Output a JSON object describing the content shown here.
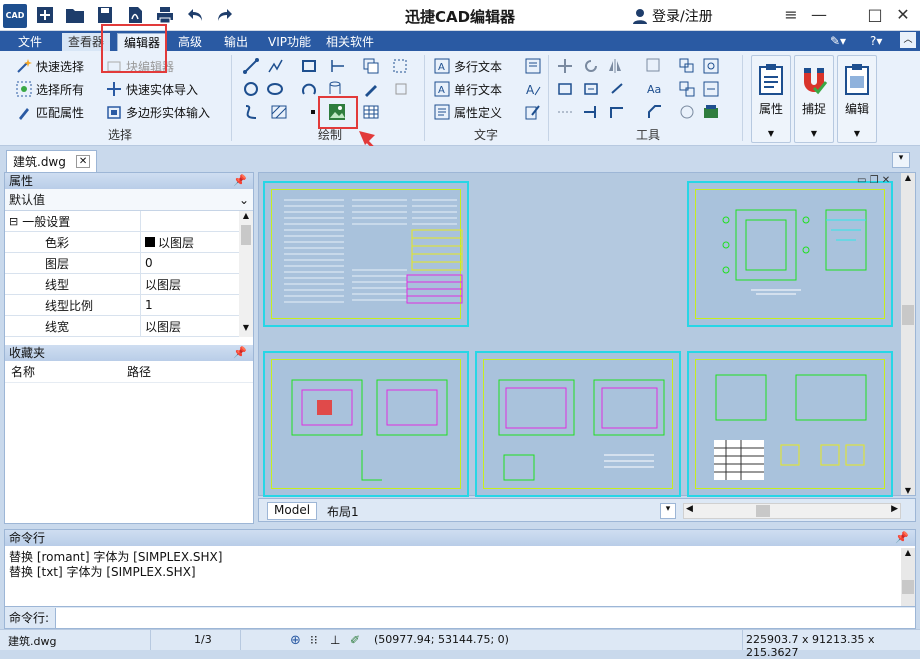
{
  "app": {
    "title": "迅捷CAD编辑器",
    "logo_text": "CAD",
    "login_label": "登录/注册"
  },
  "menu": {
    "tabs": [
      "文件",
      "查看器",
      "编辑器",
      "高级",
      "输出",
      "VIP功能",
      "相关软件"
    ],
    "active": "编辑器"
  },
  "ribbon": {
    "select_group": {
      "label": "选择",
      "quick_select": "快速选择",
      "select_all": "选择所有",
      "match_props": "匹配属性",
      "block_editor": "块编辑器",
      "quick_entity_import": "快速实体导入",
      "polygon_entity_input": "多边形实体输入"
    },
    "draw_group": {
      "label": "绘制"
    },
    "text_group": {
      "label": "文字",
      "multiline_text": "多行文本",
      "single_text": "单行文本",
      "attr_define": "属性定义"
    },
    "tools_group": {
      "label": "工具"
    },
    "big_buttons": [
      "属性",
      "捕捉",
      "编辑"
    ]
  },
  "document": {
    "tab_name": "建筑.dwg"
  },
  "properties_panel": {
    "header": "属性",
    "dropdown_value": "默认值",
    "section": "一般设置",
    "rows": [
      {
        "name": "色彩",
        "value": "以图层"
      },
      {
        "name": "图层",
        "value": "0"
      },
      {
        "name": "线型",
        "value": "以图层"
      },
      {
        "name": "线型比例",
        "value": "1"
      },
      {
        "name": "线宽",
        "value": "以图层"
      }
    ]
  },
  "favorites_panel": {
    "header": "收藏夹",
    "col_name": "名称",
    "col_path": "路径"
  },
  "layout_tabs": [
    "Model",
    "布局1"
  ],
  "command": {
    "header": "命令行",
    "lines": [
      "替换 [romant] 字体为 [SIMPLEX.SHX]",
      "替换 [txt] 字体为 [SIMPLEX.SHX]"
    ],
    "prompt": "命令行:"
  },
  "status": {
    "file": "建筑.dwg",
    "page": "1/3",
    "coords": "(50977.94; 53144.75; 0)",
    "dims": "225903.7 x 91213.35 x 215.3627"
  },
  "colors": {
    "menubar": "#2a5aa3",
    "ribbon_bg": "#e9f1fb",
    "highlight_red": "#e23a3a",
    "sheet_border": "#27d6e6",
    "drawing_green": "#1fe01f"
  }
}
